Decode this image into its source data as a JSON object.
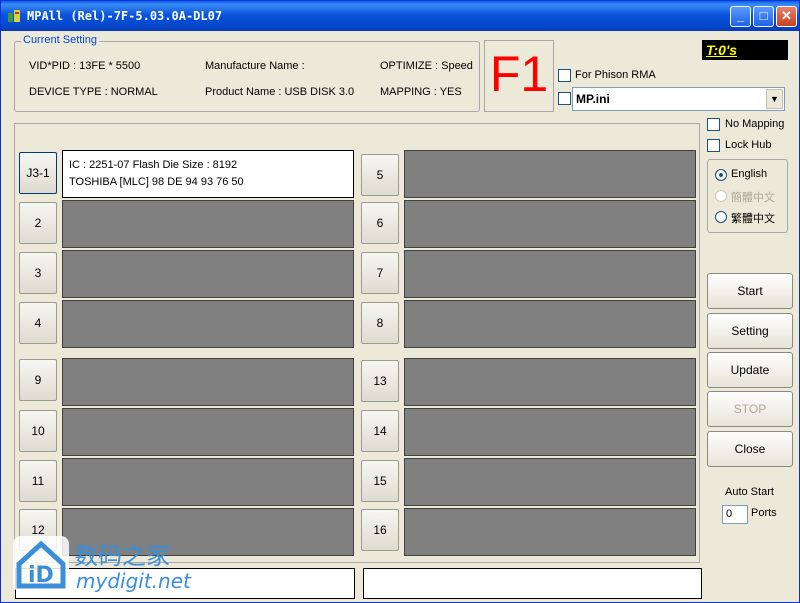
{
  "window": {
    "title": "MPAll (Rel)-7F-5.03.0A-DL07",
    "minimize": "_",
    "maximize": "□",
    "close": "✕"
  },
  "current_setting": {
    "label": "Current Setting",
    "vid_pid": "VID*PID : 13FE * 5500",
    "device_type": "DEVICE TYPE : NORMAL",
    "manufacture_name": "Manufacture Name :",
    "product_name": "Product Name : USB DISK 3.0",
    "optimize": "OPTIMIZE : Speed",
    "mapping": "MAPPING : YES"
  },
  "f1_label": "F1",
  "options": {
    "for_phison_rma": "For Phison RMA",
    "ini_file": "MP.ini",
    "timer": "T:0's",
    "no_mapping": "No Mapping",
    "lock_hub": "Lock Hub"
  },
  "language": {
    "english": "English",
    "simplified_chinese": "簡體中文",
    "traditional_chinese": "繁體中文",
    "selected": "English"
  },
  "ports": {
    "p1": {
      "label": "J3-1",
      "line1": "IC : 2251-07  Flash Die Size : 8192",
      "line2": "TOSHIBA [MLC] 98 DE 94 93 76 50"
    },
    "p2": {
      "label": "2"
    },
    "p3": {
      "label": "3"
    },
    "p4": {
      "label": "4"
    },
    "p5": {
      "label": "5"
    },
    "p6": {
      "label": "6"
    },
    "p7": {
      "label": "7"
    },
    "p8": {
      "label": "8"
    },
    "p9": {
      "label": "9"
    },
    "p10": {
      "label": "10"
    },
    "p11": {
      "label": "11"
    },
    "p12": {
      "label": "12"
    },
    "p13": {
      "label": "13"
    },
    "p14": {
      "label": "14"
    },
    "p15": {
      "label": "15"
    },
    "p16": {
      "label": "16"
    }
  },
  "buttons": {
    "start": "Start",
    "setting": "Setting",
    "update": "Update",
    "stop": "STOP",
    "close": "Close"
  },
  "auto_start": {
    "label": "Auto Start",
    "value": "0",
    "unit": "Ports"
  },
  "watermark": {
    "cn": "数码之家",
    "en": "mydigit.net"
  },
  "colors": {
    "title_bar": "#0a55dc",
    "f1": "#ff0000",
    "timer_bg": "#000000",
    "timer_fg": "#ffff00",
    "port_idle": "#808080",
    "watermark": "#3a8fd8"
  }
}
